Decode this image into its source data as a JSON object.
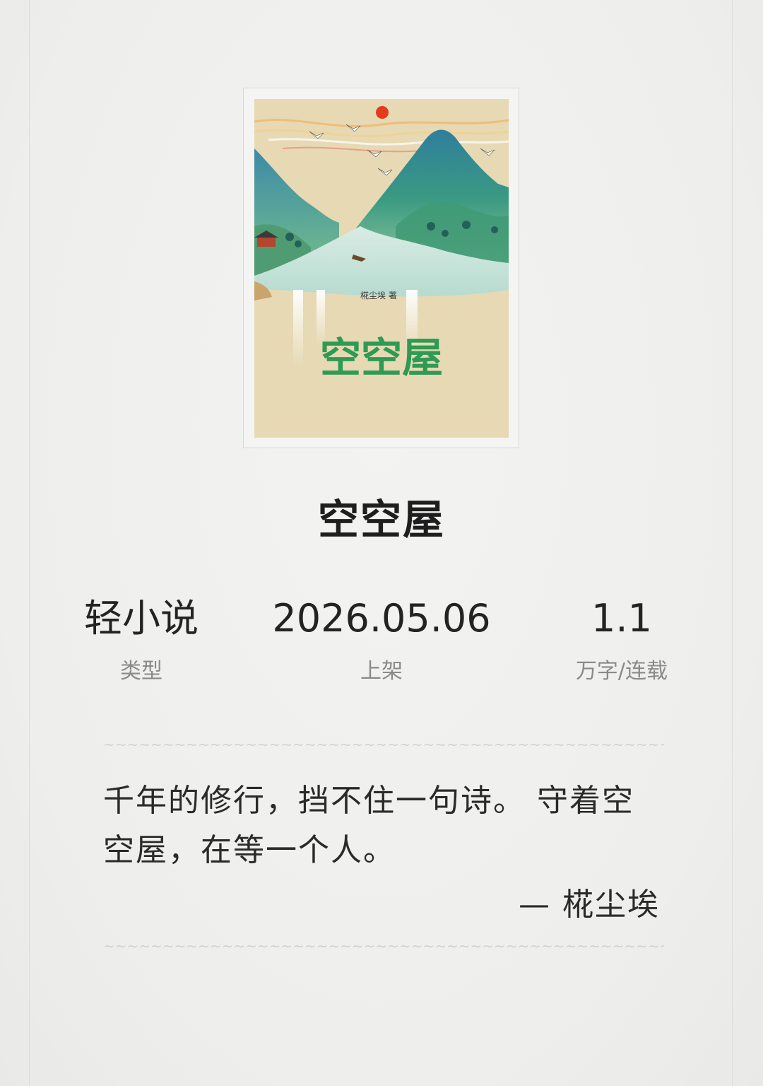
{
  "book": {
    "title": "空空屋",
    "cover": {
      "title_text": "空空屋",
      "author_text": "椛尘埃 著",
      "title_color": "#2e9a54",
      "background_color": "#e6d9b3"
    }
  },
  "stats": [
    {
      "value": "轻小说",
      "label": "类型"
    },
    {
      "value": "2026.05.06",
      "label": "上架"
    },
    {
      "value": "1.1",
      "label": "万字/连载"
    }
  ],
  "blurb": {
    "text": "千年的修行，挡不住一句诗。 守着空空屋，在等一个人。",
    "author": "— 椛尘埃"
  },
  "colors": {
    "background": "#efefed",
    "text": "#222222",
    "muted": "#8a8a8a"
  }
}
